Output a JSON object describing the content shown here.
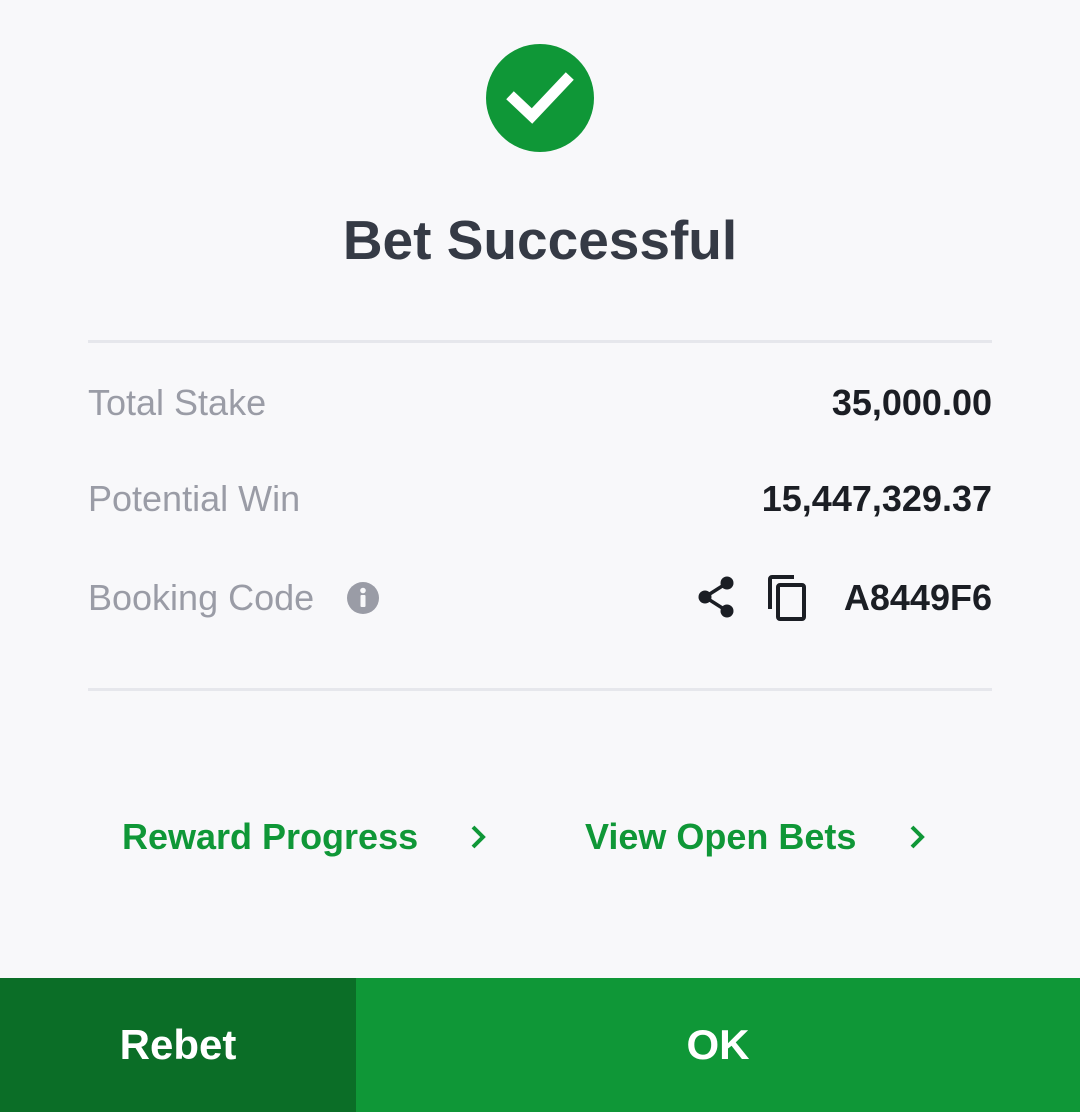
{
  "header": {
    "icon": "check-circle-icon",
    "title": "Bet Successful"
  },
  "details": {
    "total_stake_label": "Total Stake",
    "total_stake_value": "35,000.00",
    "potential_win_label": "Potential Win",
    "potential_win_value": "15,447,329.37",
    "booking_code_label": "Booking Code",
    "booking_code_value": "A8449F6",
    "icons": [
      "info-icon",
      "share-icon",
      "copy-icon"
    ]
  },
  "links": {
    "reward_progress": "Reward Progress",
    "view_open_bets": "View Open Bets"
  },
  "footer": {
    "rebet_label": "Rebet",
    "ok_label": "OK"
  },
  "colors": {
    "accent_green": "#0f9737",
    "dark_green": "#0b6e27",
    "title_text": "#353a45",
    "muted_label": "#9a9ca6"
  }
}
